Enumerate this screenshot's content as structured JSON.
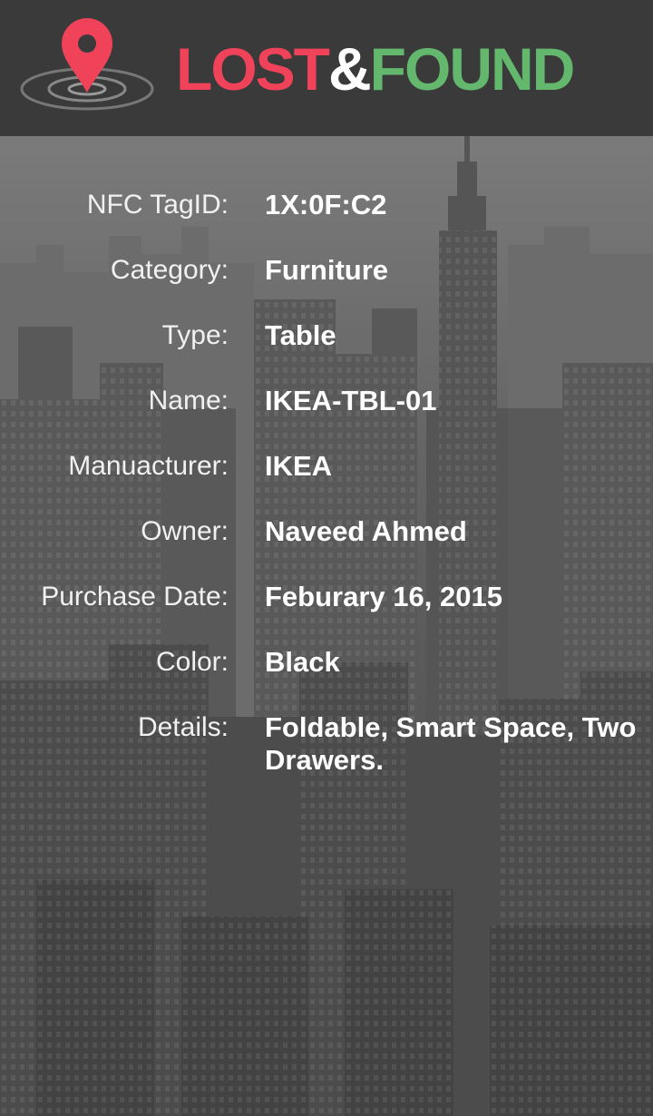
{
  "header": {
    "brand_lost": "LOST",
    "brand_amp": "&",
    "brand_found": "FOUND",
    "logo_icon": "map-pin-radar-icon",
    "colors": {
      "lost": "#f0435a",
      "found": "#63b86d",
      "header_bg": "#3a3a3a"
    }
  },
  "details": {
    "nfc_tag": {
      "label": "NFC TagID:",
      "value": "1X:0F:C2"
    },
    "category": {
      "label": "Category:",
      "value": "Furniture"
    },
    "type": {
      "label": "Type:",
      "value": "Table"
    },
    "name": {
      "label": "Name:",
      "value": "IKEA-TBL-01"
    },
    "manufacturer": {
      "label": "Manuacturer:",
      "value": "IKEA"
    },
    "owner": {
      "label": "Owner:",
      "value": "Naveed Ahmed"
    },
    "purchase_date": {
      "label": "Purchase Date:",
      "value": "Feburary 16, 2015"
    },
    "color": {
      "label": "Color:",
      "value": "Black"
    },
    "details_text": {
      "label": "Details:",
      "value": "Foldable, Smart Space, Two Drawers."
    }
  }
}
